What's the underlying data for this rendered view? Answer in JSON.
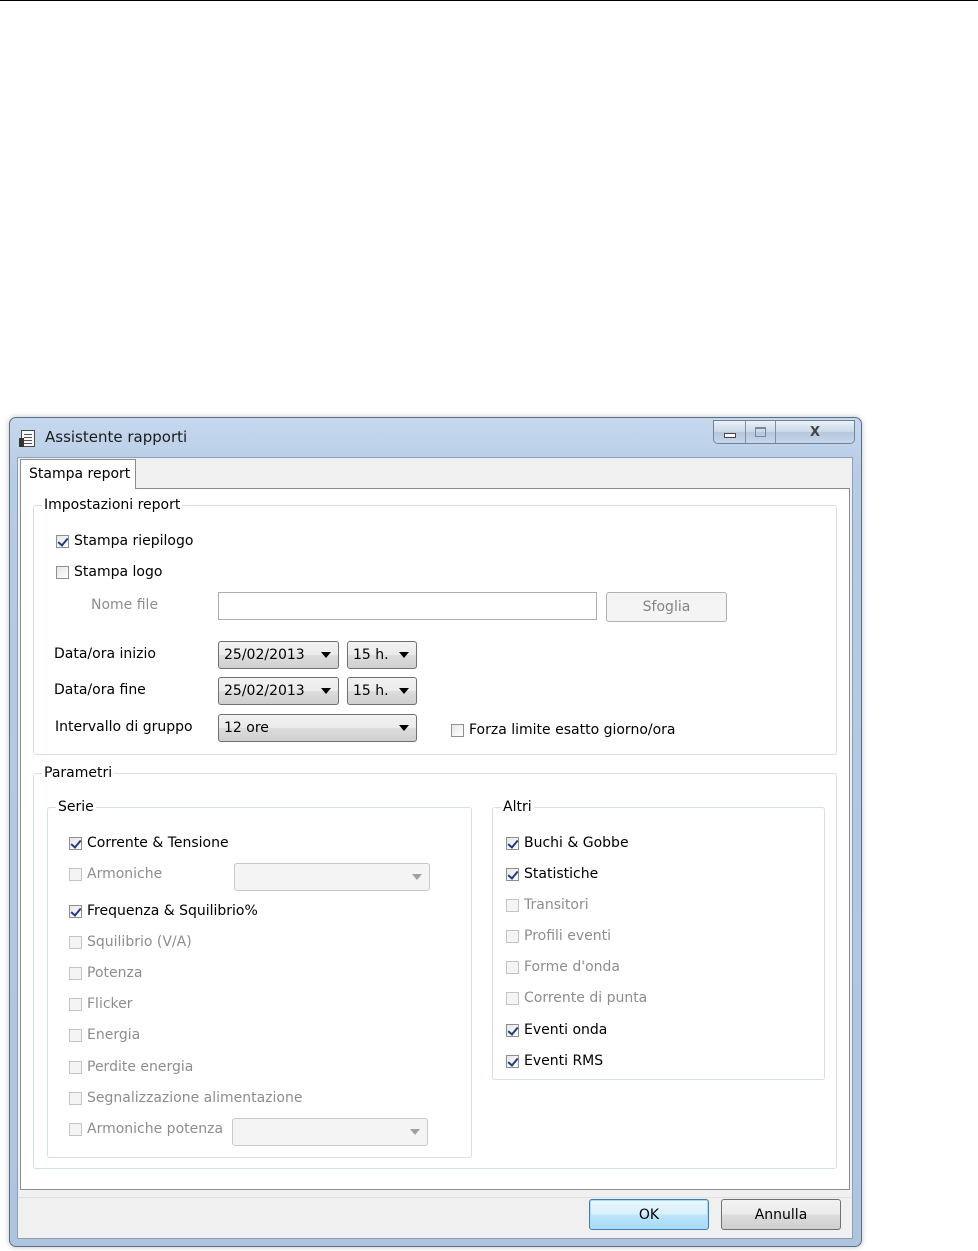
{
  "window": {
    "title": "Assistente rapporti",
    "close_glyph": "X"
  },
  "tabs": [
    {
      "label": "Stampa report",
      "selected": true
    }
  ],
  "impostazioni": {
    "legend": "Impostazioni report",
    "stampa_riepilogo": {
      "label": "Stampa riepilogo",
      "checked": true
    },
    "stampa_logo": {
      "label": "Stampa logo",
      "checked": false
    },
    "nome_file": {
      "label": "Nome file",
      "value": ""
    },
    "sfoglia_label": "Sfoglia",
    "data_inizio": {
      "label": "Data/ora inizio",
      "date": "25/02/2013",
      "hour": "15 h."
    },
    "data_fine": {
      "label": "Data/ora fine",
      "date": "25/02/2013",
      "hour": "15 h."
    },
    "intervallo": {
      "label": "Intervallo di gruppo",
      "value": "12 ore"
    },
    "forza_limite": {
      "label": "Forza limite esatto giorno/ora",
      "checked": false
    }
  },
  "parametri": {
    "legend": "Parametri",
    "serie": {
      "legend": "Serie",
      "items": [
        {
          "label": "Corrente & Tensione",
          "checked": true,
          "enabled": true
        },
        {
          "label": "Armoniche",
          "checked": false,
          "enabled": false
        },
        {
          "label": "Frequenza & Squilibrio%",
          "checked": true,
          "enabled": true
        },
        {
          "label": "Squilibrio (V/A)",
          "checked": false,
          "enabled": false
        },
        {
          "label": "Potenza",
          "checked": false,
          "enabled": false
        },
        {
          "label": "Flicker",
          "checked": false,
          "enabled": false
        },
        {
          "label": "Energia",
          "checked": false,
          "enabled": false
        },
        {
          "label": "Perdite energia",
          "checked": false,
          "enabled": false
        },
        {
          "label": "Segnalizzazione alimentazione",
          "checked": false,
          "enabled": false
        },
        {
          "label": "Armoniche potenza",
          "checked": false,
          "enabled": false
        }
      ],
      "armoniche_combo_value": "",
      "armoniche_potenza_combo_value": ""
    },
    "altri": {
      "legend": "Altri",
      "items": [
        {
          "label": "Buchi & Gobbe",
          "checked": true,
          "enabled": true
        },
        {
          "label": "Statistiche",
          "checked": true,
          "enabled": true
        },
        {
          "label": "Transitori",
          "checked": false,
          "enabled": false
        },
        {
          "label": "Profili eventi",
          "checked": false,
          "enabled": false
        },
        {
          "label": "Forme d'onda",
          "checked": false,
          "enabled": false
        },
        {
          "label": "Corrente di punta",
          "checked": false,
          "enabled": false
        },
        {
          "label": "Eventi onda",
          "checked": true,
          "enabled": true
        },
        {
          "label": "Eventi RMS",
          "checked": true,
          "enabled": true
        }
      ]
    }
  },
  "footer": {
    "ok_label": "OK",
    "annulla_label": "Annulla"
  }
}
